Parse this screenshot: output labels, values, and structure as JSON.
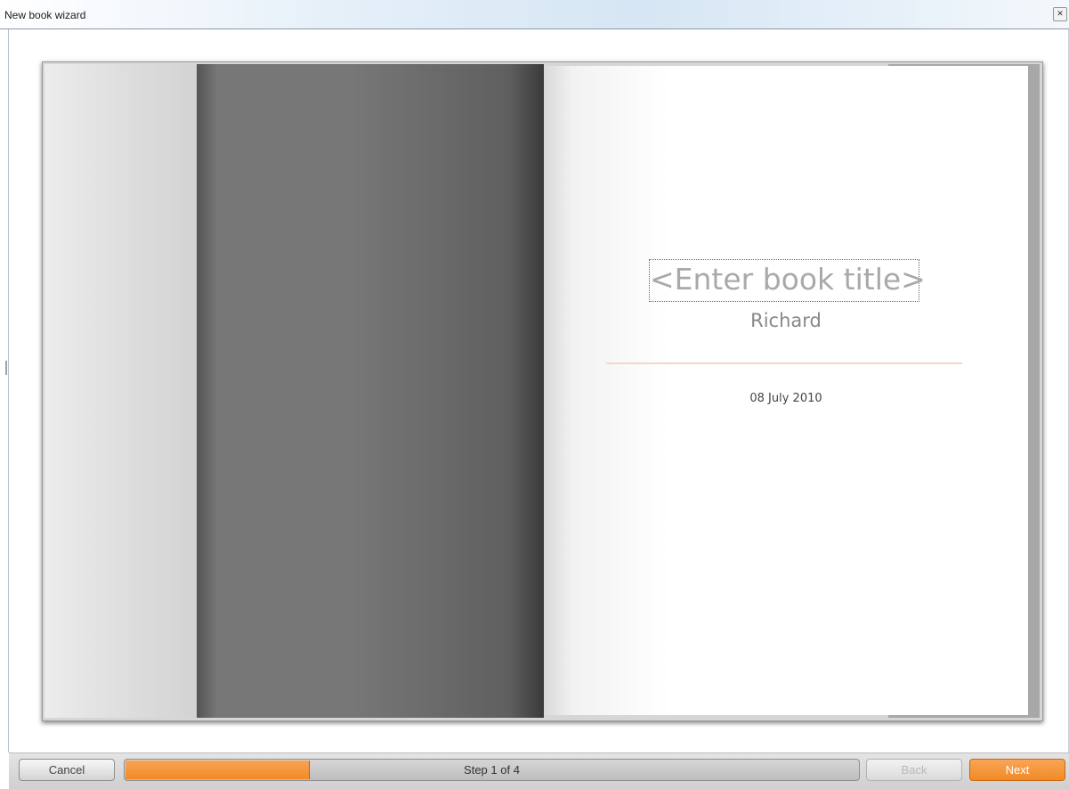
{
  "window": {
    "title": "New book wizard",
    "close_icon": "close-icon"
  },
  "book": {
    "title_placeholder": "<Enter book title>",
    "author": "Richard",
    "date": "08 July 2010"
  },
  "footer": {
    "cancel_label": "Cancel",
    "back_label": "Back",
    "next_label": "Next",
    "step_label": "Step 1 of 4",
    "current_step": 1,
    "total_steps": 4,
    "progress_fraction": 0.25
  },
  "colors": {
    "accent": "#f28a25",
    "divider": "#f4d8c6",
    "placeholder_text": "#a9a9a9"
  }
}
